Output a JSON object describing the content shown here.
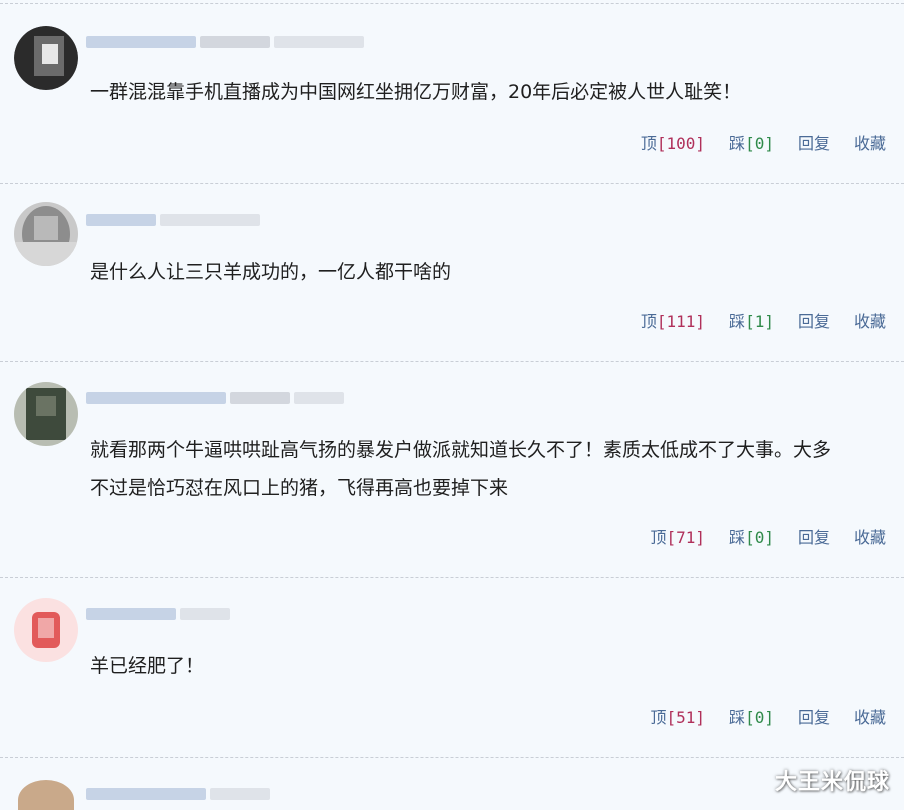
{
  "comments": [
    {
      "text": "一群混混靠手机直播成为中国网红坐拥亿万财富，20年后必定被人世人耻笑！",
      "up_label": "顶",
      "up_count": "[100]",
      "down_label": "踩",
      "down_count": "[0]",
      "reply": "回复",
      "favorite": "收藏",
      "avatar_colors": [
        "#2b2b2b",
        "#6b6b6b",
        "#e8e8e8"
      ]
    },
    {
      "text": "是什么人让三只羊成功的，一亿人都干啥的",
      "up_label": "顶",
      "up_count": "[111]",
      "down_label": "踩",
      "down_count": "[1]",
      "reply": "回复",
      "favorite": "收藏",
      "avatar_colors": [
        "#8d8d8d",
        "#b9b9b9",
        "#d7d7d7"
      ]
    },
    {
      "text": "就看那两个牛逼哄哄趾高气扬的暴发户做派就知道长久不了！素质太低成不了大事。大多",
      "text2": "不过是恰巧怼在风口上的猪，飞得再高也要掉下来",
      "up_label": "顶",
      "up_count": "[71]",
      "down_label": "踩",
      "down_count": "[0]",
      "reply": "回复",
      "favorite": "收藏",
      "avatar_colors": [
        "#3e4a3c",
        "#6a7363",
        "#b8bdb2"
      ]
    },
    {
      "text": "羊已经肥了！",
      "up_label": "顶",
      "up_count": "[51]",
      "down_label": "踩",
      "down_count": "[0]",
      "reply": "回复",
      "favorite": "收藏",
      "avatar_colors": [
        "#e25a5a",
        "#f0a7a7",
        "#fbe1e1"
      ]
    }
  ],
  "watermark": "大王米侃球",
  "colors": {
    "background": "#f5f9fd",
    "action_text": "#4a6a96",
    "up_count": "#b0305a",
    "down_count": "#2f8a4a"
  }
}
